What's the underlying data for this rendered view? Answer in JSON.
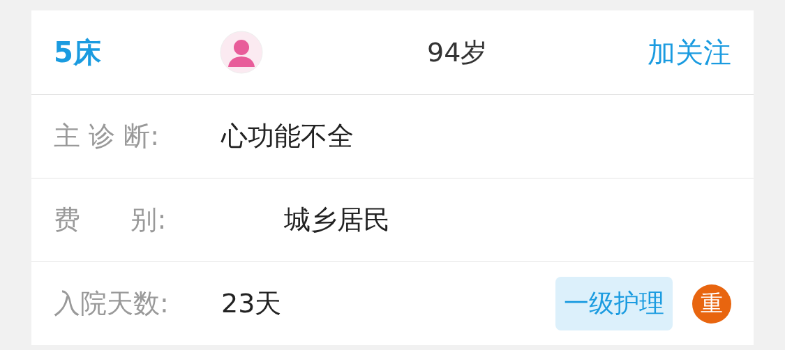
{
  "header": {
    "bed": "5床",
    "age": "94岁",
    "follow_button": "加关注"
  },
  "rows": [
    {
      "kind": "text",
      "label": "主 诊 断:",
      "value": "心功能不全"
    },
    {
      "kind": "text",
      "label": "费      别:",
      "value": "城乡居民"
    },
    {
      "kind": "tags",
      "label": "入院天数:",
      "value": "23天",
      "tag": "一级护理",
      "badge": {
        "text": "重",
        "color": "#e8650f"
      }
    }
  ]
}
